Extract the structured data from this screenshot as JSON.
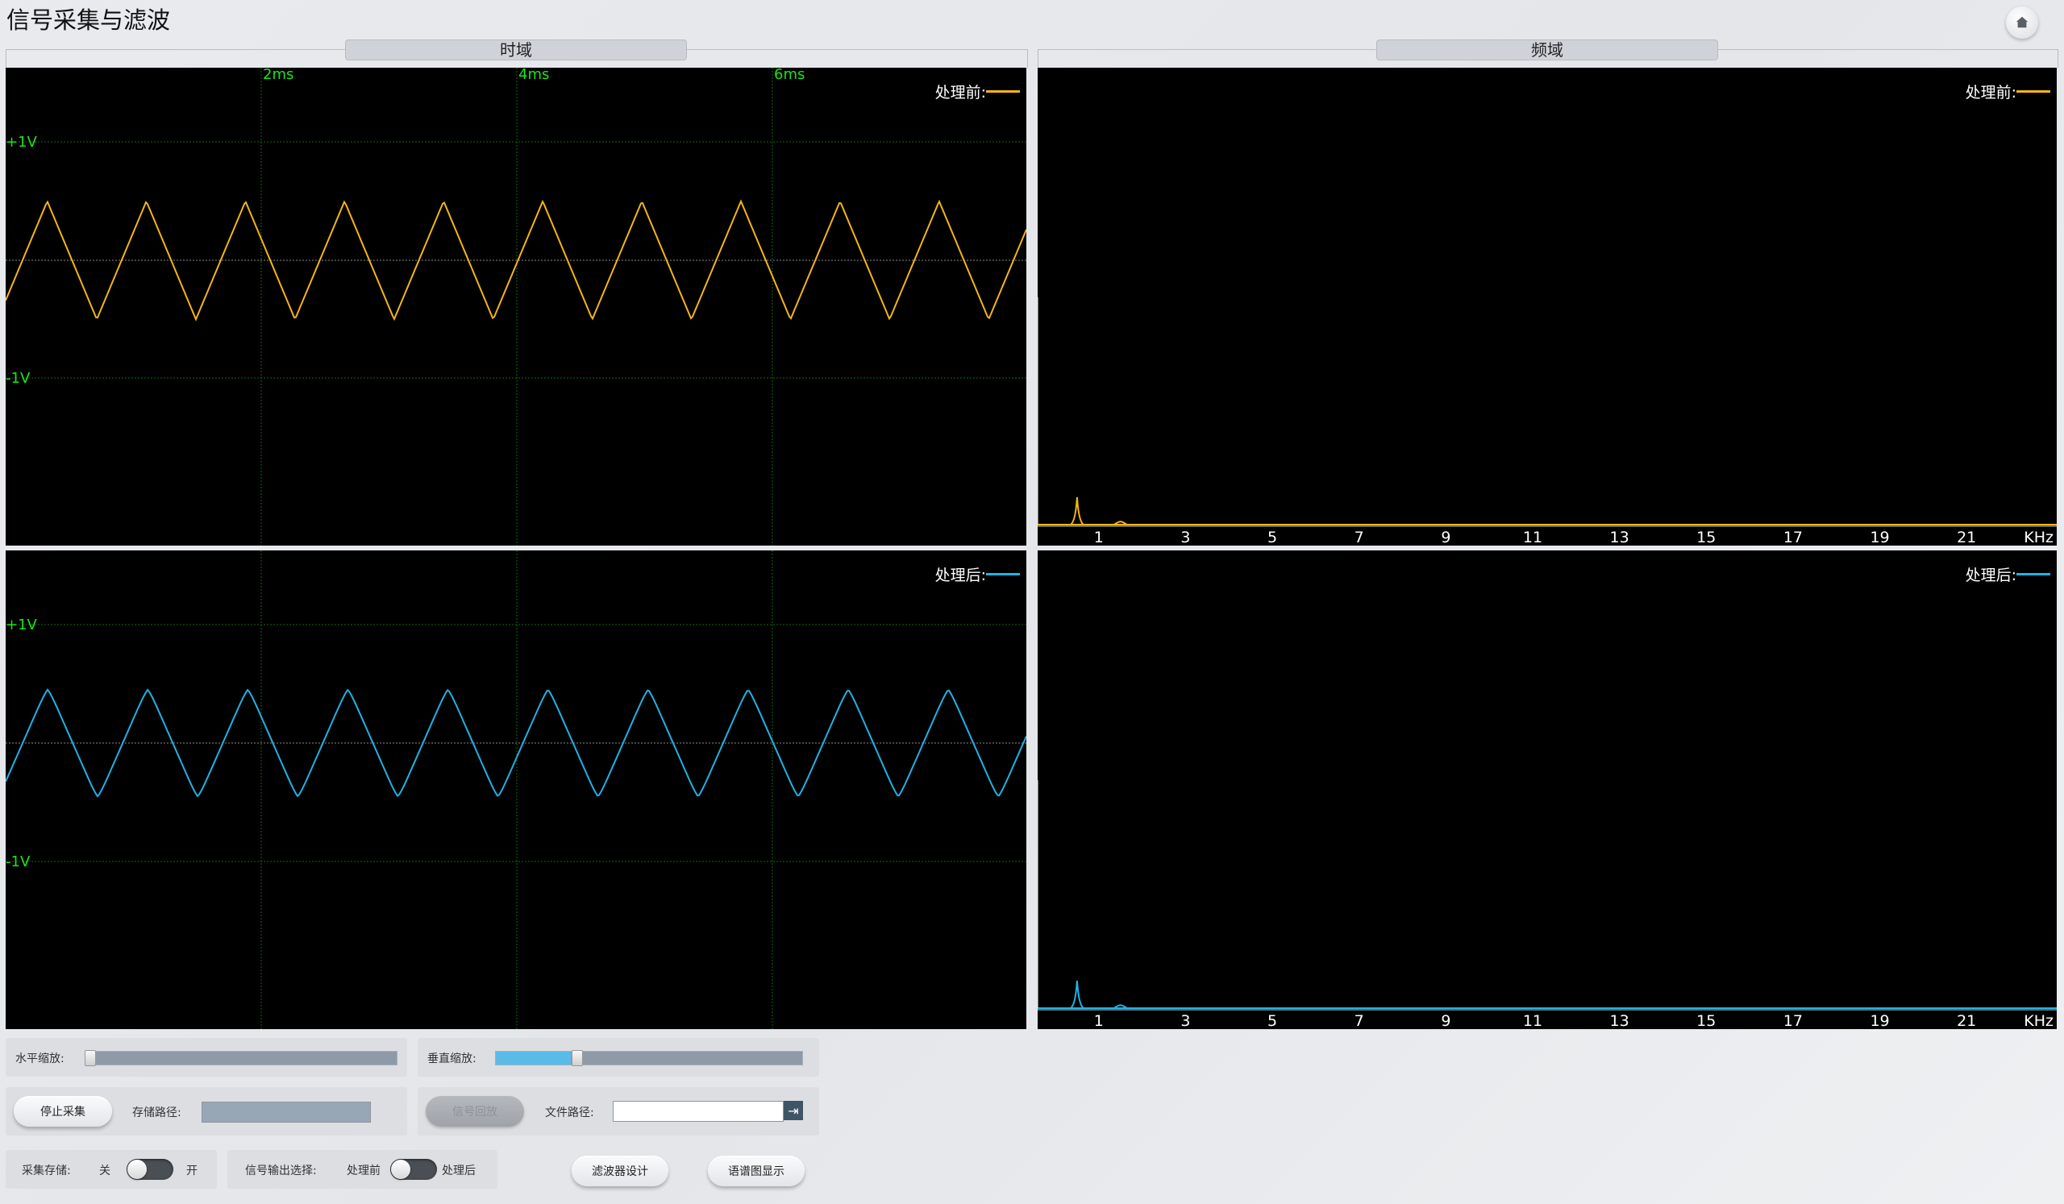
{
  "app": {
    "title": "信号采集与滤波"
  },
  "icons": {
    "home": "home-icon",
    "go": "arrow-right-icon"
  },
  "groups": {
    "time_domain": "时域",
    "freq_domain": "频域"
  },
  "colors": {
    "before": "#f5b614",
    "after": "#1fb3e6",
    "grid": "#0f6a0f",
    "axis_label": "#19e619",
    "zero_line": "#8a8a8a"
  },
  "time_plot": {
    "x_ticks": [
      "2ms",
      "4ms",
      "6ms"
    ],
    "y_ticks": [
      "+1V",
      "-1V"
    ],
    "legend_before": "处理前:",
    "legend_after": "处理后:"
  },
  "freq_plot": {
    "x_ticks": [
      "1",
      "3",
      "5",
      "7",
      "9",
      "11",
      "13",
      "15",
      "17",
      "19",
      "21"
    ],
    "unit": "KHz",
    "legend_before": "处理前:",
    "legend_after": "处理后:"
  },
  "controls": {
    "h_zoom_label": "水平缩放:",
    "h_zoom_value": 0.0,
    "v_zoom_label": "垂直缩放:",
    "v_zoom_value": 0.25,
    "stop_button": "停止采集",
    "save_path_label": "存储路径:",
    "save_path_value": "",
    "replay_button": "信号回放",
    "file_path_label": "文件路径:",
    "file_path_value": "",
    "acq_save_label": "采集存储:",
    "acq_off": "关",
    "acq_on": "开",
    "output_select_label": "信号输出选择:",
    "output_before": "处理前",
    "output_after": "处理后",
    "filter_design_button": "滤波器设计",
    "spectrogram_button": "语谱图显示"
  },
  "chart_data": [
    {
      "type": "line",
      "title": "",
      "xlabel": "",
      "ylabel": "",
      "x_ticks": [
        "2ms",
        "4ms",
        "6ms"
      ],
      "y_ticks": [
        "+1V",
        "-1V"
      ],
      "ylim": [
        -1.3,
        1.3
      ],
      "series": [
        {
          "name": "处理前:",
          "shape": "triangle",
          "amplitude": 0.5,
          "cycles": 10.3
        }
      ]
    },
    {
      "type": "line",
      "title": "",
      "xlabel": "",
      "ylabel": "",
      "x_ticks": [
        "2ms",
        "4ms",
        "6ms"
      ],
      "y_ticks": [
        "+1V",
        "-1V"
      ],
      "ylim": [
        -1.3,
        1.3
      ],
      "series": [
        {
          "name": "处理后:",
          "shape": "smoothed triangle",
          "amplitude": 0.48,
          "cycles": 10.2
        }
      ]
    },
    {
      "type": "line",
      "title": "",
      "x_ticks": [
        "1",
        "3",
        "5",
        "7",
        "9",
        "11",
        "13",
        "15",
        "17",
        "19",
        "21"
      ],
      "unit": "KHz",
      "series": [
        {
          "name": "处理前:",
          "peaks": [
            {
              "x": 0.5,
              "y": 1.0
            },
            {
              "x": 1.5,
              "y": 0.11
            }
          ]
        }
      ]
    },
    {
      "type": "line",
      "title": "",
      "x_ticks": [
        "1",
        "3",
        "5",
        "7",
        "9",
        "11",
        "13",
        "15",
        "17",
        "19",
        "21"
      ],
      "unit": "KHz",
      "series": [
        {
          "name": "处理后:",
          "peaks": [
            {
              "x": 0.5,
              "y": 1.0
            },
            {
              "x": 1.5,
              "y": 0.11
            }
          ]
        }
      ]
    }
  ]
}
